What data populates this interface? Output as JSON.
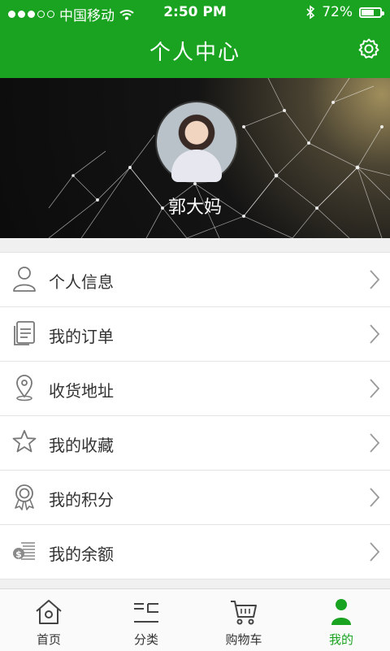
{
  "status_bar": {
    "carrier": "中国移动",
    "time": "2:50 PM",
    "battery": "72%",
    "battery_level": 0.72,
    "signal_dots": [
      true,
      true,
      true,
      false,
      false
    ]
  },
  "header": {
    "title": "个人中心",
    "settings_icon": "gear-icon"
  },
  "profile": {
    "name": "郭大妈"
  },
  "menu": {
    "items": [
      {
        "label": "个人信息",
        "icon": "user-icon"
      },
      {
        "label": "我的订单",
        "icon": "orders-icon"
      },
      {
        "label": "收货地址",
        "icon": "location-pin-icon"
      },
      {
        "label": "我的收藏",
        "icon": "star-icon"
      },
      {
        "label": "我的积分",
        "icon": "medal-icon"
      },
      {
        "label": "我的余额",
        "icon": "balance-icon"
      }
    ]
  },
  "tabbar": {
    "tabs": [
      {
        "label": "首页",
        "icon": "home-icon"
      },
      {
        "label": "分类",
        "icon": "category-icon"
      },
      {
        "label": "购物车",
        "icon": "cart-icon"
      },
      {
        "label": "我的",
        "icon": "profile-icon"
      }
    ],
    "active_index": 3
  },
  "colors": {
    "brand_green": "#1aa321",
    "text": "#333333",
    "divider": "#e3e3e3"
  }
}
